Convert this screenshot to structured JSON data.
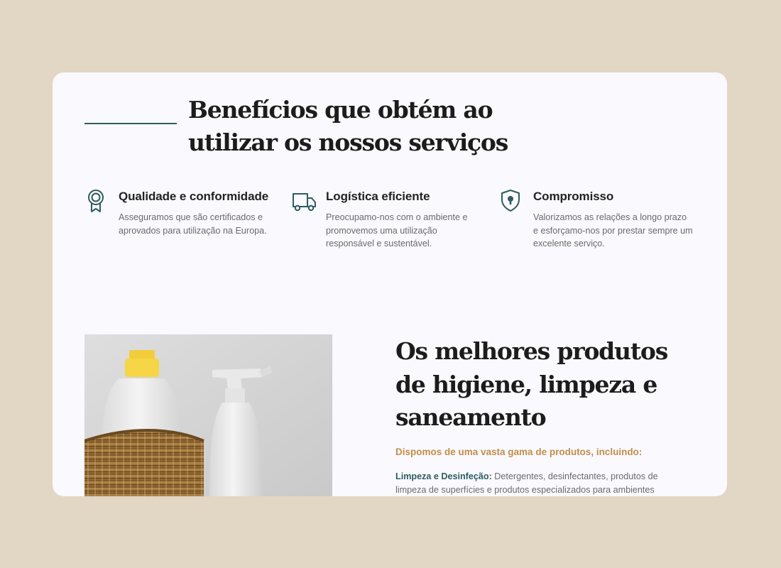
{
  "benefits": {
    "title": "Benefícios que obtém ao utilizar os nossos serviços",
    "items": [
      {
        "icon": "award-ribbon-icon",
        "title": "Qualidade e conformidade",
        "text": "Asseguramos que são certificados e aprovados para utilização na Europa."
      },
      {
        "icon": "delivery-truck-icon",
        "title": "Logística eficiente",
        "text": "Preocupamo-nos com o ambiente e promovemos uma utilização responsável e sustentável."
      },
      {
        "icon": "shield-lock-icon",
        "title": "Compromisso",
        "text": "Valorizamos as relações a longo prazo e esforçamo-nos por prestar sempre um excelente serviço."
      }
    ]
  },
  "products": {
    "title": "Os melhores produtos de higiene, limpeza e saneamento",
    "subtitle": "Dispomos de uma vasta gama de produtos, incluindo:",
    "item_term": "Limpeza e Desinfeção:",
    "item_text": " Detergentes, desinfectantes, produtos de limpeza de superfícies e produtos especializados para ambientes"
  },
  "colors": {
    "background": "#e2d6c5",
    "card": "#f9f9fe",
    "accent": "#2e5c61",
    "highlight": "#c28e4a"
  }
}
